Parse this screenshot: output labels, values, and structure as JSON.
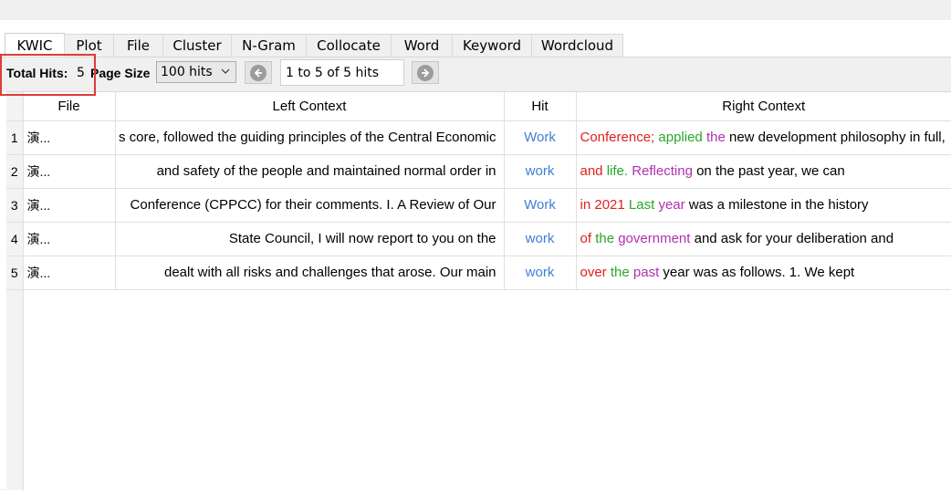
{
  "tabs": [
    "KWIC",
    "Plot",
    "File",
    "Cluster",
    "N-Gram",
    "Collocate",
    "Word",
    "Keyword",
    "Wordcloud"
  ],
  "toolbar": {
    "total_hits_label": "Total Hits:",
    "total_hits_value": "5",
    "page_size_label": "Page Size",
    "page_size_value": "100 hits",
    "page_info": "1 to 5 of 5 hits"
  },
  "columns": [
    "File",
    "Left Context",
    "Hit",
    "Right Context"
  ],
  "rows": [
    {
      "num": "1",
      "file": "演...",
      "left": "s core, followed the guiding principles of the Central Economic",
      "hit": "Work",
      "right": [
        [
          "Conference;",
          "red"
        ],
        [
          " ",
          "black"
        ],
        [
          "applied",
          "green"
        ],
        [
          " ",
          "black"
        ],
        [
          "the",
          "purple"
        ],
        [
          " new development philosophy in full,",
          "black"
        ]
      ]
    },
    {
      "num": "2",
      "file": "演...",
      "left": "and safety of the people and maintained normal order in",
      "hit": "work",
      "right": [
        [
          "and",
          "red"
        ],
        [
          " ",
          "black"
        ],
        [
          "life.",
          "green"
        ],
        [
          " ",
          "black"
        ],
        [
          "Reflecting",
          "purple"
        ],
        [
          " on the past year, we can",
          "black"
        ]
      ]
    },
    {
      "num": "3",
      "file": "演...",
      "left": "Conference (CPPCC) for their comments. I. A Review of Our",
      "hit": "Work",
      "right": [
        [
          "in",
          "red"
        ],
        [
          " ",
          "black"
        ],
        [
          "2021",
          "red"
        ],
        [
          " ",
          "black"
        ],
        [
          "Last",
          "green"
        ],
        [
          " ",
          "black"
        ],
        [
          "year",
          "purple"
        ],
        [
          " was a milestone in the history",
          "black"
        ]
      ]
    },
    {
      "num": "4",
      "file": "演...",
      "left": "State Council, I will now report to you on the",
      "hit": "work",
      "right": [
        [
          "of",
          "red"
        ],
        [
          " ",
          "black"
        ],
        [
          "the",
          "green"
        ],
        [
          " ",
          "black"
        ],
        [
          "government",
          "purple"
        ],
        [
          " and ask for your deliberation and",
          "black"
        ]
      ]
    },
    {
      "num": "5",
      "file": "演...",
      "left": "dealt with all risks and challenges that arose. Our main",
      "hit": "work",
      "right": [
        [
          "over",
          "red"
        ],
        [
          " ",
          "black"
        ],
        [
          "the",
          "green"
        ],
        [
          " ",
          "black"
        ],
        [
          "past",
          "purple"
        ],
        [
          " year was as follows. 1. We kept",
          "black"
        ]
      ]
    }
  ],
  "colors": {
    "hit": "#3f7fd4",
    "red": "#e02020",
    "green": "#28a828",
    "purple": "#b030b0",
    "highlight_box": "#e03a3a"
  }
}
